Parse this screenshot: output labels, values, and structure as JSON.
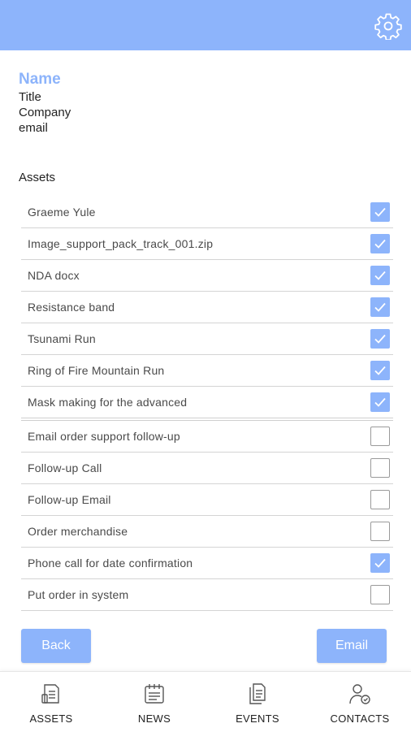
{
  "profile": {
    "name": "Name",
    "title": "Title",
    "company": "Company",
    "email": "email"
  },
  "assets_section": {
    "title": "Assets"
  },
  "rows": [
    {
      "label": "Graeme Yule",
      "checked": true
    },
    {
      "label": "Image_support_pack_track_001.zip",
      "checked": true
    },
    {
      "label": "NDA docx",
      "checked": true
    },
    {
      "label": "Resistance band",
      "checked": true
    },
    {
      "label": "Tsunami Run",
      "checked": true
    },
    {
      "label": "Ring of Fire Mountain Run",
      "checked": true
    },
    {
      "label": "Mask making for the advanced",
      "checked": true
    },
    {
      "label": "Email order support follow-up",
      "checked": false
    },
    {
      "label": "Follow-up Call",
      "checked": false
    },
    {
      "label": "Follow-up Email",
      "checked": false
    },
    {
      "label": "Order merchandise",
      "checked": false
    },
    {
      "label": "Phone call for date confirmation",
      "checked": true
    },
    {
      "label": "Put order in system",
      "checked": false
    }
  ],
  "buttons": {
    "back": "Back",
    "email": "Email"
  },
  "tabs": [
    {
      "label": "ASSETS",
      "icon": "assets-icon"
    },
    {
      "label": "NEWS",
      "icon": "news-icon"
    },
    {
      "label": "EVENTS",
      "icon": "events-icon"
    },
    {
      "label": "CONTACTS",
      "icon": "contacts-icon"
    }
  ],
  "colors": {
    "accent": "#8db4fb",
    "divider": "#d4d4d4",
    "text": "#4a4a4a"
  },
  "header": {
    "icon": "gear-icon"
  }
}
